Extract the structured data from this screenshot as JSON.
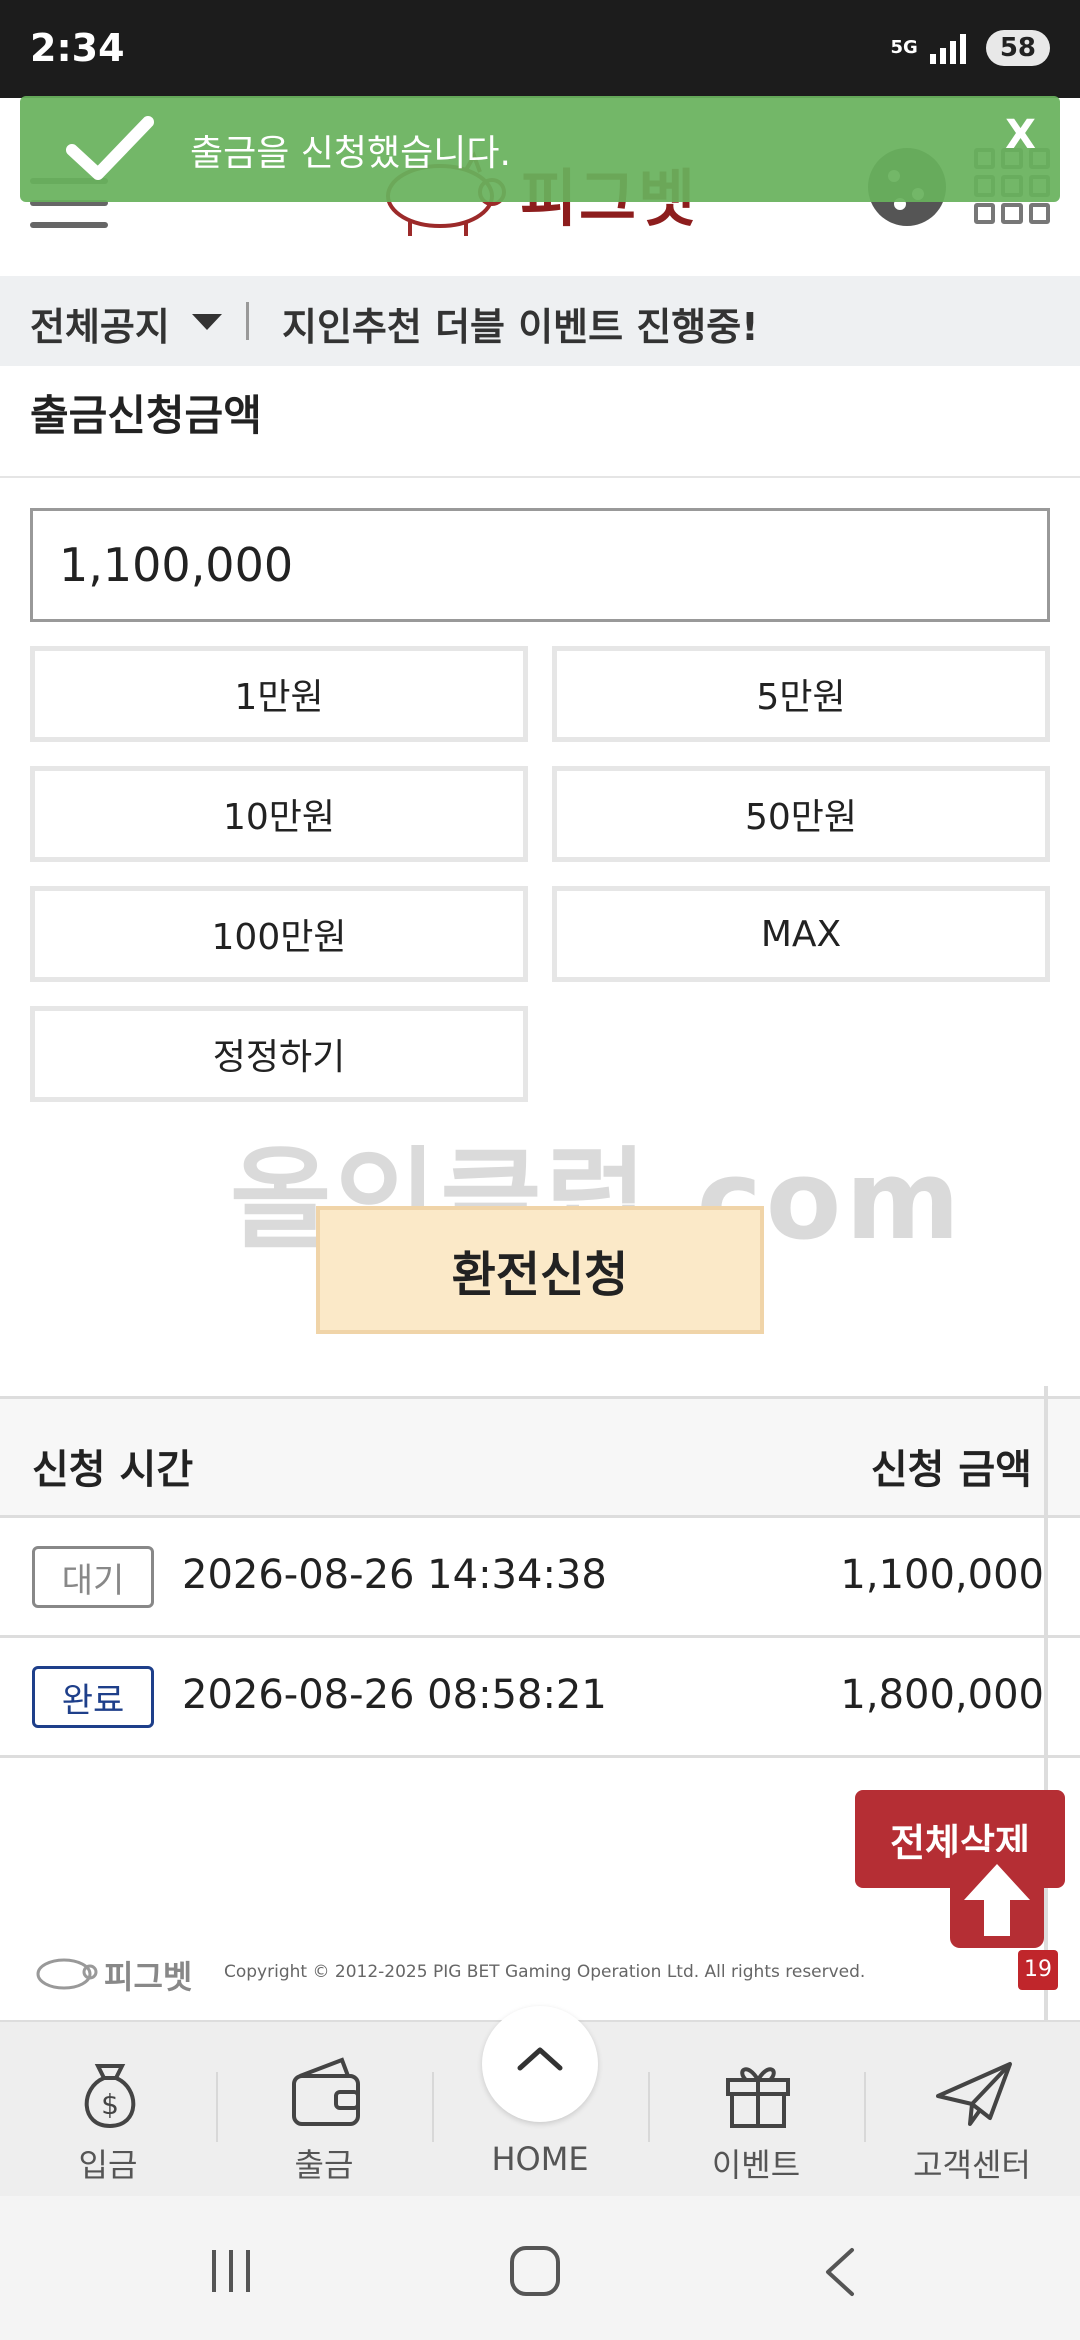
{
  "status_bar": {
    "time": "2:34",
    "network": "5G",
    "battery": "58"
  },
  "header": {
    "logo_text": "피그벳"
  },
  "toast": {
    "message": "출금을 신청했습니다.",
    "close_label": "X",
    "color": "#68b25c"
  },
  "notice": {
    "category": "전체공지",
    "text": "지인추천 더블 이벤트 진행중!"
  },
  "withdraw": {
    "title": "출금신청금액",
    "amount_value": "1,100,000",
    "quick_buttons": [
      "1만원",
      "5만원",
      "10만원",
      "50만원",
      "100만원",
      "MAX",
      "정정하기"
    ],
    "submit_label": "환전신청"
  },
  "watermark": "올인클럽.com",
  "history": {
    "col_time": "신청 시간",
    "col_amount": "신청 금액",
    "rows": [
      {
        "status": "대기",
        "time": "2026-08-26 14:34:38",
        "amount": "1,100,000",
        "status_color": "#888888"
      },
      {
        "status": "완료",
        "time": "2026-08-26 08:58:21",
        "amount": "1,800,000",
        "status_color": "#1e3f8a"
      }
    ],
    "delete_all_label": "전체삭제"
  },
  "footer": {
    "logo_text": "피그벳",
    "copyright": "Copyright © 2012-2025 PIG BET Gaming Operation Ltd. All rights reserved.",
    "age_badge": "19"
  },
  "tabbar": {
    "tabs": [
      {
        "label": "입금",
        "icon": "money-bag-icon"
      },
      {
        "label": "출금",
        "icon": "wallet-icon"
      },
      {
        "label": "HOME",
        "icon": "home-icon"
      },
      {
        "label": "이벤트",
        "icon": "gift-icon"
      },
      {
        "label": "고객센터",
        "icon": "paper-plane-icon"
      }
    ]
  },
  "colors": {
    "accent_red": "#b52e34",
    "submit_bg": "#fbe9c8"
  }
}
